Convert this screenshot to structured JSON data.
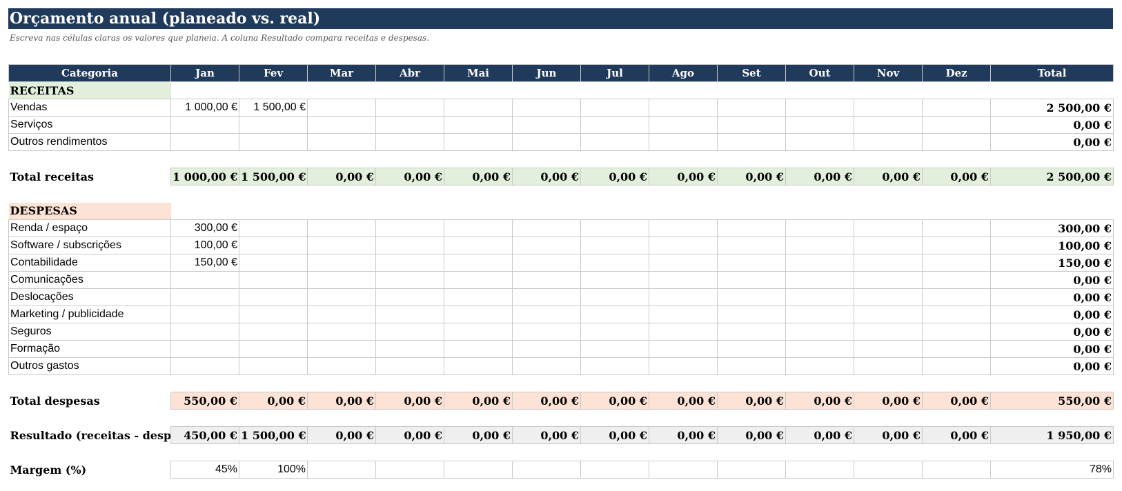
{
  "title": "Orçamento anual (planeado vs. real)",
  "subtitle": "Escreva nas células claras os valores que planeia. A coluna Resultado compara receitas e despesas.",
  "columns": [
    "Categoria",
    "Jan",
    "Fev",
    "Mar",
    "Abr",
    "Mai",
    "Jun",
    "Jul",
    "Ago",
    "Set",
    "Out",
    "Nov",
    "Dez",
    "Total"
  ],
  "receitas": {
    "header": "RECEITAS",
    "rows": [
      {
        "label": "Vendas",
        "values": [
          "1 000,00 €",
          "1 500,00 €",
          "",
          "",
          "",
          "",
          "",
          "",
          "",
          "",
          "",
          ""
        ],
        "total": "2 500,00 €"
      },
      {
        "label": "Serviços",
        "values": [
          "",
          "",
          "",
          "",
          "",
          "",
          "",
          "",
          "",
          "",
          "",
          ""
        ],
        "total": "0,00 €"
      },
      {
        "label": "Outros rendimentos",
        "values": [
          "",
          "",
          "",
          "",
          "",
          "",
          "",
          "",
          "",
          "",
          "",
          ""
        ],
        "total": "0,00 €"
      }
    ],
    "total_label": "Total receitas",
    "total_values": [
      "1 000,00 €",
      "1 500,00 €",
      "0,00 €",
      "0,00 €",
      "0,00 €",
      "0,00 €",
      "0,00 €",
      "0,00 €",
      "0,00 €",
      "0,00 €",
      "0,00 €",
      "0,00 €"
    ],
    "total_total": "2 500,00 €"
  },
  "despesas": {
    "header": "DESPESAS",
    "rows": [
      {
        "label": "Renda / espaço",
        "values": [
          "300,00 €",
          "",
          "",
          "",
          "",
          "",
          "",
          "",
          "",
          "",
          "",
          ""
        ],
        "total": "300,00 €"
      },
      {
        "label": "Software / subscrições",
        "values": [
          "100,00 €",
          "",
          "",
          "",
          "",
          "",
          "",
          "",
          "",
          "",
          "",
          ""
        ],
        "total": "100,00 €"
      },
      {
        "label": "Contabilidade",
        "values": [
          "150,00 €",
          "",
          "",
          "",
          "",
          "",
          "",
          "",
          "",
          "",
          "",
          ""
        ],
        "total": "150,00 €"
      },
      {
        "label": "Comunicações",
        "values": [
          "",
          "",
          "",
          "",
          "",
          "",
          "",
          "",
          "",
          "",
          "",
          ""
        ],
        "total": "0,00 €"
      },
      {
        "label": "Deslocações",
        "values": [
          "",
          "",
          "",
          "",
          "",
          "",
          "",
          "",
          "",
          "",
          "",
          ""
        ],
        "total": "0,00 €"
      },
      {
        "label": "Marketing / publicidade",
        "values": [
          "",
          "",
          "",
          "",
          "",
          "",
          "",
          "",
          "",
          "",
          "",
          ""
        ],
        "total": "0,00 €"
      },
      {
        "label": "Seguros",
        "values": [
          "",
          "",
          "",
          "",
          "",
          "",
          "",
          "",
          "",
          "",
          "",
          ""
        ],
        "total": "0,00 €"
      },
      {
        "label": "Formação",
        "values": [
          "",
          "",
          "",
          "",
          "",
          "",
          "",
          "",
          "",
          "",
          "",
          ""
        ],
        "total": "0,00 €"
      },
      {
        "label": "Outros gastos",
        "values": [
          "",
          "",
          "",
          "",
          "",
          "",
          "",
          "",
          "",
          "",
          "",
          ""
        ],
        "total": "0,00 €"
      }
    ],
    "total_label": "Total despesas",
    "total_values": [
      "550,00 €",
      "0,00 €",
      "0,00 €",
      "0,00 €",
      "0,00 €",
      "0,00 €",
      "0,00 €",
      "0,00 €",
      "0,00 €",
      "0,00 €",
      "0,00 €",
      "0,00 €"
    ],
    "total_total": "550,00 €"
  },
  "resultado": {
    "label": "Resultado (receitas - despesas)",
    "values": [
      "450,00 €",
      "1 500,00 €",
      "0,00 €",
      "0,00 €",
      "0,00 €",
      "0,00 €",
      "0,00 €",
      "0,00 €",
      "0,00 €",
      "0,00 €",
      "0,00 €",
      "0,00 €"
    ],
    "total": "1 950,00 €"
  },
  "margem": {
    "label": "Margem (%)",
    "values": [
      "45%",
      "100%",
      "",
      "",
      "",
      "",
      "",
      "",
      "",
      "",
      "",
      ""
    ],
    "total": "78%"
  }
}
